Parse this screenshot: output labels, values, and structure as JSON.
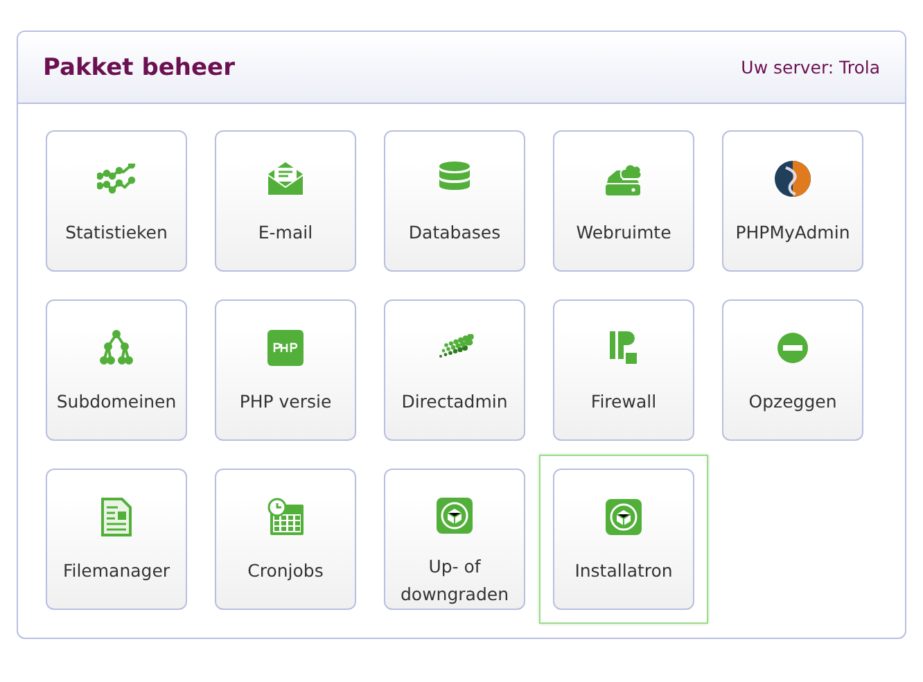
{
  "panel": {
    "title": "Pakket beheer",
    "server": "Uw server: Trola"
  },
  "tiles": [
    {
      "label": "Statistieken",
      "kind": "stats",
      "selected": false
    },
    {
      "label": "E-mail",
      "kind": "mail",
      "selected": false
    },
    {
      "label": "Databases",
      "kind": "database",
      "selected": false
    },
    {
      "label": "Webruimte",
      "kind": "webspace",
      "selected": false
    },
    {
      "label": "PHPMyAdmin",
      "kind": "phpmyadmin",
      "selected": false
    },
    {
      "label": "Subdomeinen",
      "kind": "tree",
      "selected": false
    },
    {
      "label": "PHP versie",
      "kind": "php",
      "selected": false
    },
    {
      "label": "Directadmin",
      "kind": "dots",
      "selected": false
    },
    {
      "label": "Firewall",
      "kind": "firewall",
      "selected": false
    },
    {
      "label": "Opzeggen",
      "kind": "cancel",
      "selected": false
    },
    {
      "label": "Filemanager",
      "kind": "file",
      "selected": false
    },
    {
      "label": "Cronjobs",
      "kind": "calendar",
      "selected": false
    },
    {
      "label": "Up- of downgraden",
      "kind": "box",
      "selected": false
    },
    {
      "label": "Installatron",
      "kind": "box",
      "selected": true
    }
  ]
}
